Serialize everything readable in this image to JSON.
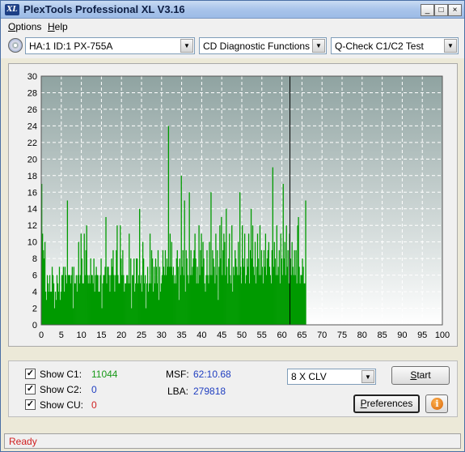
{
  "window": {
    "title": "PlexTools Professional XL V3.16",
    "icon_text": "XL"
  },
  "window_controls": {
    "minimize": "_",
    "maximize": "□",
    "close": "×"
  },
  "menu": {
    "options_ul": "O",
    "options_rest": "ptions",
    "help_ul": "H",
    "help_rest": "elp"
  },
  "toolbar": {
    "drive": "HA:1 ID:1  PX-755A",
    "function": "CD Diagnostic Functions",
    "test": "Q-Check C1/C2 Test"
  },
  "chart_data": {
    "type": "bar",
    "x_ticks": [
      0,
      5,
      10,
      15,
      20,
      25,
      30,
      35,
      40,
      45,
      50,
      55,
      60,
      65,
      70,
      75,
      80,
      85,
      90,
      95,
      100
    ],
    "y_ticks": [
      0,
      2,
      4,
      6,
      8,
      10,
      12,
      14,
      16,
      18,
      20,
      22,
      24,
      26,
      28,
      30
    ],
    "xlim": [
      0,
      100
    ],
    "ylim": [
      0,
      30
    ],
    "grid": true,
    "progress_marker_x": 62,
    "series": [
      {
        "color": "#009a00",
        "x_start": 0,
        "x_step": 0.2,
        "values": [
          17,
          11,
          9,
          8,
          10,
          4,
          3,
          6,
          5,
          4,
          6,
          4,
          4,
          7,
          6,
          5,
          2,
          4,
          3,
          6,
          5,
          4,
          7,
          3,
          4,
          6,
          6,
          7,
          4,
          7,
          6,
          5,
          15,
          6,
          6,
          6,
          5,
          6,
          7,
          2,
          7,
          5,
          5,
          6,
          4,
          6,
          10,
          5,
          6,
          11,
          8,
          5,
          5,
          11,
          6,
          9,
          12,
          6,
          5,
          6,
          5,
          8,
          6,
          6,
          5,
          8,
          4,
          6,
          7,
          6,
          6,
          4,
          4,
          6,
          8,
          2,
          5,
          6,
          6,
          7,
          13,
          5,
          7,
          7,
          6,
          4,
          6,
          8,
          7,
          9,
          6,
          4,
          6,
          9,
          12,
          6,
          5,
          5,
          12,
          8,
          6,
          9,
          6,
          4,
          5,
          5,
          6,
          6,
          5,
          11,
          5,
          8,
          2,
          6,
          6,
          8,
          4,
          5,
          8,
          8,
          5,
          6,
          14,
          5,
          6,
          4,
          10,
          8,
          5,
          6,
          2,
          5,
          7,
          4,
          5,
          11,
          5,
          9,
          8,
          4,
          7,
          5,
          8,
          7,
          5,
          9,
          3,
          7,
          4,
          5,
          6,
          9,
          7,
          6,
          9,
          6,
          8,
          7,
          24,
          7,
          11,
          7,
          10,
          6,
          7,
          5,
          6,
          5,
          8,
          9,
          7,
          3,
          8,
          6,
          18,
          7,
          9,
          6,
          15,
          4,
          9,
          8,
          6,
          5,
          16,
          6,
          9,
          6,
          7,
          8,
          9,
          11,
          8,
          5,
          7,
          5,
          12,
          6,
          9,
          11,
          7,
          10,
          8,
          5,
          4,
          6,
          9,
          6,
          5,
          10,
          6,
          16,
          6,
          9,
          8,
          7,
          5,
          11,
          6,
          9,
          3,
          7,
          12,
          8,
          13,
          6,
          9,
          11,
          10,
          6,
          14,
          7,
          5,
          8,
          11,
          6,
          5,
          12,
          4,
          7,
          6,
          9,
          8,
          7,
          6,
          10,
          6,
          16,
          7,
          5,
          12,
          8,
          7,
          11,
          5,
          6,
          8,
          7,
          11,
          5,
          9,
          14,
          8,
          12,
          7,
          6,
          10,
          5,
          7,
          11,
          8,
          6,
          12,
          6,
          9,
          7,
          5,
          9,
          7,
          11,
          6,
          8,
          9,
          10,
          7,
          6,
          5,
          9,
          19,
          7,
          10,
          8,
          6,
          12,
          6,
          7,
          9,
          5,
          11,
          8,
          6,
          17,
          8,
          10,
          6,
          12,
          7,
          9,
          5,
          11,
          8,
          6,
          10,
          7,
          6,
          9,
          6,
          9,
          5,
          12,
          13,
          7,
          5,
          6,
          6,
          8,
          7,
          5,
          5,
          15
        ]
      }
    ]
  },
  "options": {
    "show_c1": {
      "label": "Show C1:",
      "checked": "✓",
      "value": "11044"
    },
    "show_c2": {
      "label": "Show C2:",
      "checked": "✓",
      "value": "0"
    },
    "show_cu": {
      "label": "Show CU:",
      "checked": "✓",
      "value": "0"
    }
  },
  "position": {
    "msf_label": "MSF:",
    "msf_value": "62:10.68",
    "lba_label": "LBA:",
    "lba_value": "279818"
  },
  "speed": {
    "selected": "8 X CLV"
  },
  "buttons": {
    "start_ul": "S",
    "start_rest": "tart",
    "preferences_ul": "P",
    "preferences_rest": "references",
    "info_glyph": "i"
  },
  "status": {
    "text": "Ready"
  },
  "colors": {
    "bar": "#009a00",
    "plot_bg_top": "#8fa3a1",
    "plot_bg_bottom": "#ffffff",
    "accent_blue": "#1f3ec0",
    "accent_red": "#d02020",
    "accent_green": "#1a9a1a"
  }
}
